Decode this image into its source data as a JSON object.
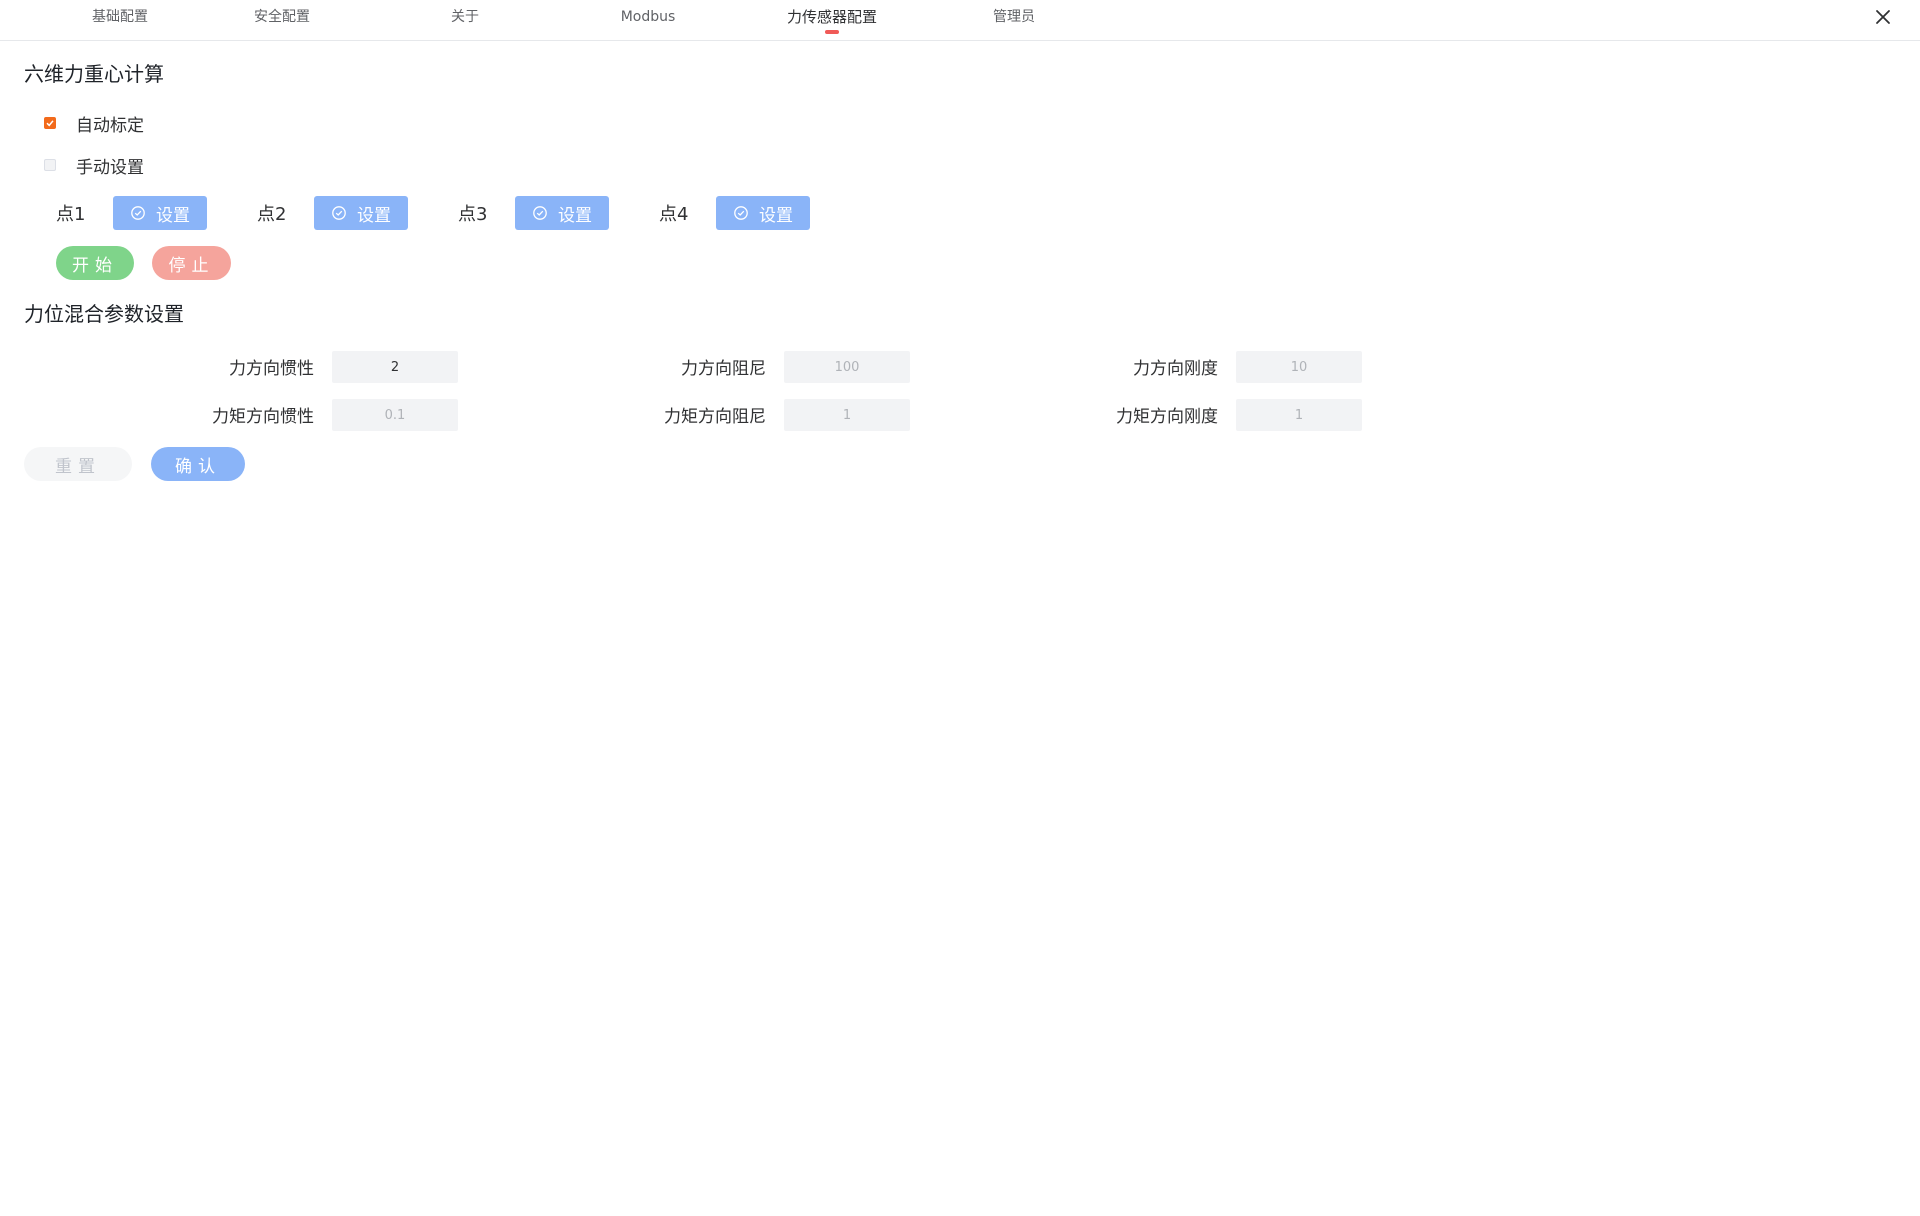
{
  "tabs": [
    {
      "label": "基础配置"
    },
    {
      "label": "安全配置"
    },
    {
      "label": "关于"
    },
    {
      "label": "Modbus"
    },
    {
      "label": "力传感器配置"
    },
    {
      "label": "管理员"
    }
  ],
  "active_tab": "力传感器配置",
  "colors": {
    "accent_orange": "#f26a1b",
    "set_button": "#8ab4f8",
    "start_button": "#7fd48a",
    "stop_button": "#f5a49c",
    "confirm_button": "#8ab4f8",
    "tab_indicator": "#f05a57"
  },
  "gravity": {
    "title": "六维力重心计算",
    "auto_calibrate": {
      "label": "自动标定",
      "checked": true
    },
    "manual_set": {
      "label": "手动设置",
      "checked": false
    },
    "points": [
      {
        "label": "点1",
        "button": "设置"
      },
      {
        "label": "点2",
        "button": "设置"
      },
      {
        "label": "点3",
        "button": "设置"
      },
      {
        "label": "点4",
        "button": "设置"
      }
    ],
    "start_label": "开始",
    "stop_label": "停止"
  },
  "hybrid": {
    "title": "力位混合参数设置",
    "fields": [
      {
        "label": "力方向惯性",
        "value": "2"
      },
      {
        "label": "力方向阻尼",
        "value": "100"
      },
      {
        "label": "力方向刚度",
        "value": "10"
      },
      {
        "label": "力矩方向惯性",
        "value": "0.1"
      },
      {
        "label": "力矩方向阻尼",
        "value": "1"
      },
      {
        "label": "力矩方向刚度",
        "value": "1"
      }
    ],
    "reset_label": "重置",
    "confirm_label": "确认"
  },
  "icons": [
    "close-icon",
    "check-circle-icon",
    "checkmark-icon"
  ]
}
